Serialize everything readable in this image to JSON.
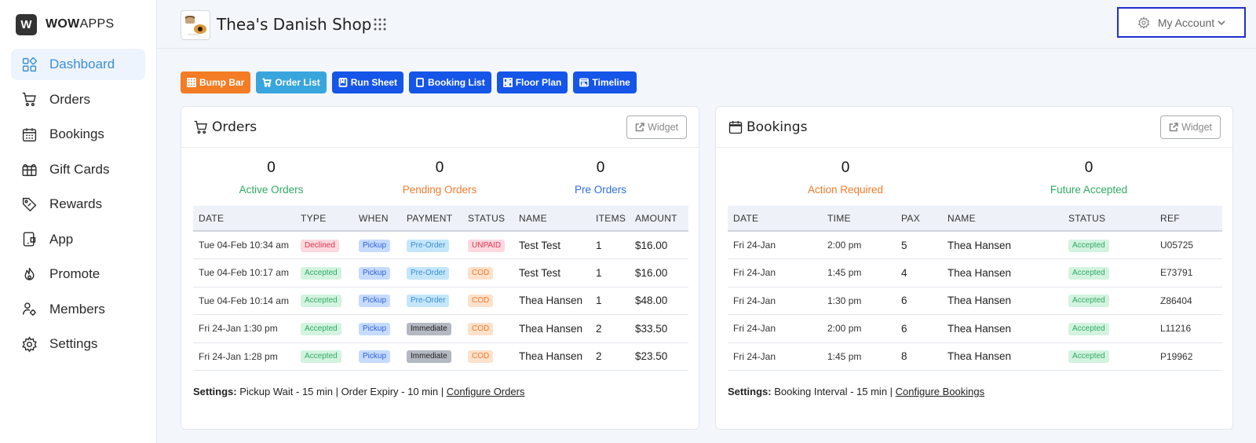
{
  "brand": {
    "logo_letter": "W",
    "name_bold": "WOW",
    "name_rest": "APPS"
  },
  "sidebar": {
    "items": [
      {
        "label": "Dashboard",
        "icon": "dashboard-icon"
      },
      {
        "label": "Orders",
        "icon": "cart-icon"
      },
      {
        "label": "Bookings",
        "icon": "calendar-icon"
      },
      {
        "label": "Gift Cards",
        "icon": "gift-card-icon"
      },
      {
        "label": "Rewards",
        "icon": "tag-icon"
      },
      {
        "label": "App",
        "icon": "app-icon"
      },
      {
        "label": "Promote",
        "icon": "promote-icon"
      },
      {
        "label": "Members",
        "icon": "members-icon"
      },
      {
        "label": "Settings",
        "icon": "gear-icon"
      }
    ]
  },
  "header": {
    "shop_name": "Thea's Danish Shop",
    "account_label": "My Account"
  },
  "toolbar": {
    "bump_bar": "Bump Bar",
    "order_list": "Order List",
    "run_sheet": "Run Sheet",
    "booking_list": "Booking List",
    "floor_plan": "Floor Plan",
    "timeline": "Timeline"
  },
  "colors": {
    "accent": "#3d8fd1",
    "orange": "#f47c24",
    "blue": "#1555e8",
    "lightblue": "#39a5dd"
  },
  "orders": {
    "title": "Orders",
    "widget_label": "Widget",
    "stats": [
      {
        "value": "0",
        "label": "Active Orders"
      },
      {
        "value": "0",
        "label": "Pending Orders"
      },
      {
        "value": "0",
        "label": "Pre Orders"
      }
    ],
    "columns": [
      "DATE",
      "TYPE",
      "WHEN",
      "PAYMENT",
      "STATUS",
      "NAME",
      "ITEMS",
      "AMOUNT"
    ],
    "rows": [
      {
        "date": "Tue 04-Feb 10:34 am",
        "type": "Declined",
        "when": "Pickup",
        "payment": "Pre-Order",
        "status": "UNPAID",
        "name": "Test Test",
        "items": "1",
        "amount": "$16.00"
      },
      {
        "date": "Tue 04-Feb 10:17 am",
        "type": "Accepted",
        "when": "Pickup",
        "payment": "Pre-Order",
        "status": "COD",
        "name": "Test Test",
        "items": "1",
        "amount": "$16.00"
      },
      {
        "date": "Tue 04-Feb 10:14 am",
        "type": "Accepted",
        "when": "Pickup",
        "payment": "Pre-Order",
        "status": "COD",
        "name": "Thea Hansen",
        "items": "1",
        "amount": "$48.00"
      },
      {
        "date": "Fri 24-Jan 1:30 pm",
        "type": "Accepted",
        "when": "Pickup",
        "payment": "Immediate",
        "status": "COD",
        "name": "Thea Hansen",
        "items": "2",
        "amount": "$33.50"
      },
      {
        "date": "Fri 24-Jan 1:28 pm",
        "type": "Accepted",
        "when": "Pickup",
        "payment": "Immediate",
        "status": "COD",
        "name": "Thea Hansen",
        "items": "2",
        "amount": "$23.50"
      }
    ],
    "settings_label": "Settings:",
    "settings_text": "Pickup Wait - 15 min | Order Expiry - 10 min |",
    "settings_link": "Configure Orders"
  },
  "bookings": {
    "title": "Bookings",
    "widget_label": "Widget",
    "stats": [
      {
        "value": "0",
        "label": "Action Required"
      },
      {
        "value": "0",
        "label": "Future Accepted"
      }
    ],
    "columns": [
      "DATE",
      "TIME",
      "PAX",
      "NAME",
      "STATUS",
      "REF"
    ],
    "rows": [
      {
        "date": "Fri 24-Jan",
        "time": "2:00 pm",
        "pax": "5",
        "name": "Thea Hansen",
        "status": "Accepted",
        "ref": "U05725"
      },
      {
        "date": "Fri 24-Jan",
        "time": "1:45 pm",
        "pax": "4",
        "name": "Thea Hansen",
        "status": "Accepted",
        "ref": "E73791"
      },
      {
        "date": "Fri 24-Jan",
        "time": "1:30 pm",
        "pax": "6",
        "name": "Thea Hansen",
        "status": "Accepted",
        "ref": "Z86404"
      },
      {
        "date": "Fri 24-Jan",
        "time": "2:00 pm",
        "pax": "6",
        "name": "Thea Hansen",
        "status": "Accepted",
        "ref": "L11216"
      },
      {
        "date": "Fri 24-Jan",
        "time": "1:45 pm",
        "pax": "8",
        "name": "Thea Hansen",
        "status": "Accepted",
        "ref": "P19962"
      }
    ],
    "settings_label": "Settings:",
    "settings_text": "Booking Interval - 15 min |",
    "settings_link": "Configure Bookings"
  }
}
